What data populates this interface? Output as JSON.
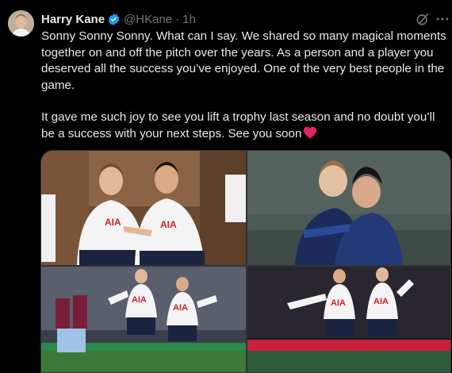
{
  "tweet": {
    "author_name": "Harry Kane",
    "handle": "@HKane",
    "separator": "·",
    "time": "1h",
    "paragraphs": [
      "Sonny Sonny Sonny. What can I say. We shared so many magical moments together on and off the pitch over the years. As a person and a player you deserved all the success you’ve enjoyed. One of the very best people in the game.",
      "It gave me such joy to see you lift a trophy last season and no doubt you’ll be a success with your next steps. See you soon"
    ],
    "icons": {
      "verified": "verified-badge-icon",
      "grok": "grok-icon",
      "more": "more-options-icon",
      "heart": "red-heart-emoji"
    },
    "colors": {
      "background": "#000000",
      "text": "#e7e9ea",
      "secondary": "#71767b",
      "verified": "#1d9bf0",
      "heart": "#e0245e"
    },
    "photos": [
      {
        "shirt_text": "AIA",
        "scene": "dressing-room selfie"
      },
      {
        "shirt_text": "",
        "scene": "training embrace"
      },
      {
        "shirt_text": "AIA",
        "scene": "goal celebration"
      },
      {
        "shirt_text": "AIA",
        "scene": "night match celebration"
      }
    ]
  }
}
